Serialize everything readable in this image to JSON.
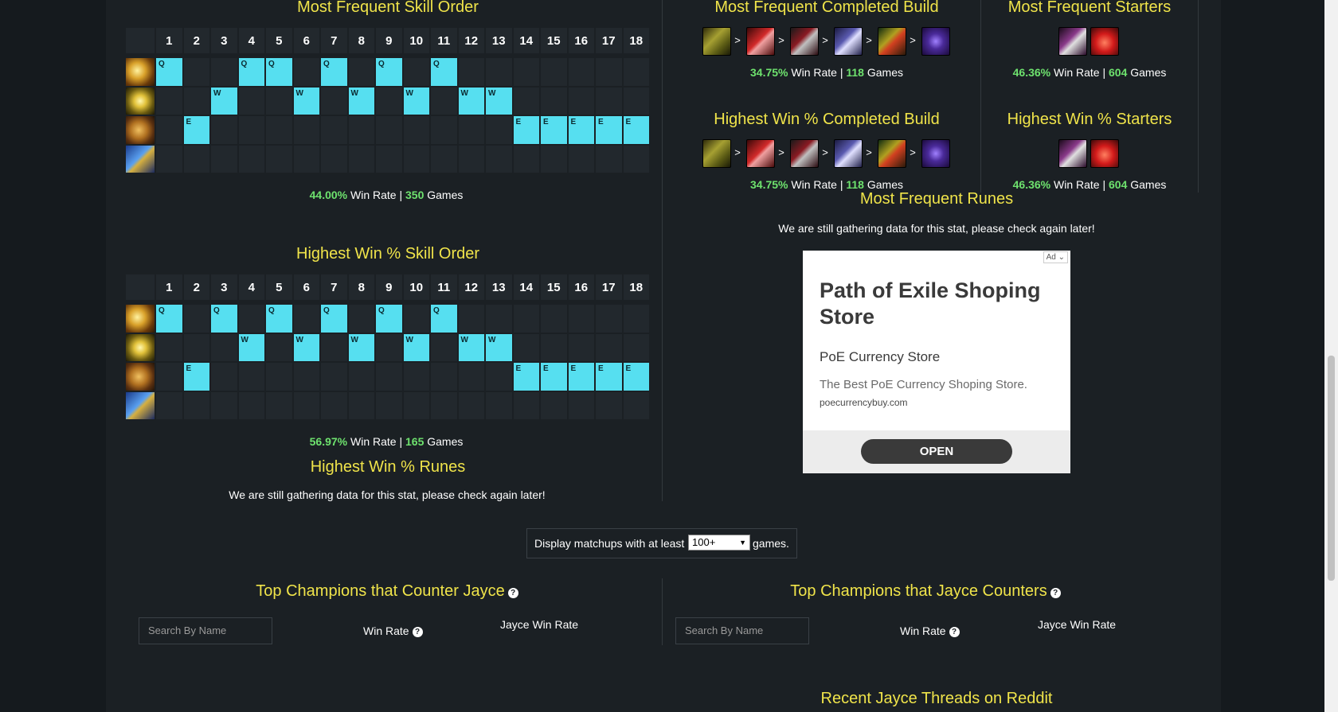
{
  "skill_orders": {
    "most_frequent": {
      "title": "Most Frequent Skill Order",
      "levels": [
        "1",
        "2",
        "3",
        "4",
        "5",
        "6",
        "7",
        "8",
        "9",
        "10",
        "11",
        "12",
        "13",
        "14",
        "15",
        "16",
        "17",
        "18"
      ],
      "abilities": [
        {
          "key": "Q",
          "icon": "ability-q-icon",
          "levels": [
            1,
            4,
            5,
            7,
            9,
            11
          ]
        },
        {
          "key": "W",
          "icon": "ability-w-icon",
          "levels": [
            3,
            6,
            8,
            10,
            12,
            13
          ]
        },
        {
          "key": "E",
          "icon": "ability-e-icon",
          "levels": [
            2,
            14,
            15,
            16,
            17,
            18
          ]
        },
        {
          "key": "R",
          "icon": "ability-r-icon",
          "levels": []
        }
      ],
      "win_rate": "44.00%",
      "win_rate_label": "Win Rate |",
      "games": "350",
      "games_label": "Games"
    },
    "highest_win": {
      "title": "Highest Win % Skill Order",
      "levels": [
        "1",
        "2",
        "3",
        "4",
        "5",
        "6",
        "7",
        "8",
        "9",
        "10",
        "11",
        "12",
        "13",
        "14",
        "15",
        "16",
        "17",
        "18"
      ],
      "abilities": [
        {
          "key": "Q",
          "icon": "ability-q-icon",
          "levels": [
            1,
            3,
            5,
            7,
            9,
            11
          ]
        },
        {
          "key": "W",
          "icon": "ability-w-icon",
          "levels": [
            4,
            6,
            8,
            10,
            12,
            13
          ]
        },
        {
          "key": "E",
          "icon": "ability-e-icon",
          "levels": [
            2,
            14,
            15,
            16,
            17,
            18
          ]
        },
        {
          "key": "R",
          "icon": "ability-r-icon",
          "levels": []
        }
      ],
      "win_rate": "56.97%",
      "win_rate_label": "Win Rate |",
      "games": "165",
      "games_label": "Games"
    }
  },
  "runes": {
    "highest_win": {
      "title": "Highest Win % Runes",
      "note": "We are still gathering data for this stat, please check again later!"
    },
    "most_frequent": {
      "title": "Most Frequent Runes",
      "note": "We are still gathering data for this stat, please check again later!"
    }
  },
  "builds": {
    "most_frequent": {
      "title": "Most Frequent Completed Build",
      "items": [
        "boots-icon",
        "bf-sword-icon",
        "ravenous-hydra-icon",
        "spear-icon",
        "blade-icon",
        "edge-of-night-icon"
      ],
      "win_rate": "34.75%",
      "win_rate_label": "Win Rate |",
      "games": "118",
      "games_label": "Games"
    },
    "highest_win": {
      "title": "Highest Win % Completed Build",
      "items": [
        "boots-icon",
        "bf-sword-icon",
        "ravenous-hydra-icon",
        "spear-icon",
        "blade-icon",
        "edge-of-night-icon"
      ],
      "win_rate": "34.75%",
      "win_rate_label": "Win Rate |",
      "games": "118",
      "games_label": "Games"
    }
  },
  "starters": {
    "most_frequent": {
      "title": "Most Frequent Starters",
      "items": [
        "long-sword-icon",
        "health-potion-icon"
      ],
      "win_rate": "46.36%",
      "win_rate_label": "Win Rate |",
      "games": "604",
      "games_label": "Games"
    },
    "highest_win": {
      "title": "Highest Win % Starters",
      "items": [
        "long-sword-icon",
        "health-potion-icon"
      ],
      "win_rate": "46.36%",
      "win_rate_label": "Win Rate |",
      "games": "604",
      "games_label": "Games"
    }
  },
  "arrow": ">",
  "ad": {
    "badge": "Ad",
    "title": "Path of Exile Shoping Store",
    "subtitle": "PoE Currency Store",
    "description": "The Best PoE Currency Shoping Store.",
    "url": "poecurrencybuy.com",
    "button": "OPEN"
  },
  "filter": {
    "prefix": "Display matchups with at least",
    "selected": "100+",
    "suffix": "games."
  },
  "counters": {
    "left": {
      "title": "Top Champions that Counter Jayce",
      "search_placeholder": "Search By Name",
      "win_rate_header": "Win Rate",
      "jayce_win_rate_header": "Jayce Win Rate"
    },
    "right": {
      "title": "Top Champions that Jayce Counters",
      "search_placeholder": "Search By Name",
      "win_rate_header": "Win Rate",
      "jayce_win_rate_header": "Jayce Win Rate"
    }
  },
  "reddit": {
    "title": "Recent Jayce Threads on Reddit"
  },
  "help_glyph": "?"
}
